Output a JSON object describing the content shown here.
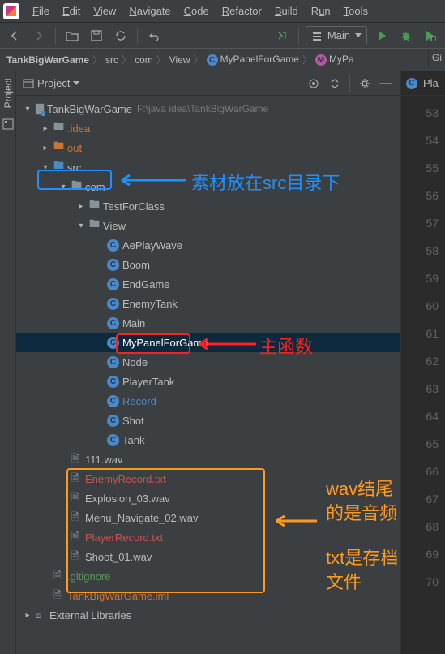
{
  "menu": [
    "File",
    "Edit",
    "View",
    "Navigate",
    "Code",
    "Refactor",
    "Build",
    "Run",
    "Tools"
  ],
  "runConfig": "Main",
  "breadcrumbs": [
    {
      "label": "TankBigWarGame",
      "icon": null,
      "bold": true
    },
    {
      "label": "src",
      "icon": null
    },
    {
      "label": "com",
      "icon": null
    },
    {
      "label": "View",
      "icon": null
    },
    {
      "label": "MyPanelForGame",
      "icon": "c"
    },
    {
      "label": "MyPa",
      "icon": "m"
    }
  ],
  "sideTab": {
    "label": "Project"
  },
  "gitTab": "Gi",
  "panelTitle": "Project",
  "editorTab": "Pla",
  "lineNumbers": [
    "53",
    "54",
    "55",
    "56",
    "57",
    "58",
    "59",
    "60",
    "61",
    "62",
    "63",
    "64",
    "65",
    "66",
    "67",
    "68",
    "69",
    "70"
  ],
  "tree": [
    {
      "depth": 0,
      "chev": "down",
      "icon": "module",
      "label": "TankBigWarGame",
      "cls": "",
      "suffix": "F:\\java idea\\TankBigWarGame"
    },
    {
      "depth": 1,
      "chev": "right",
      "icon": "folder",
      "label": ".idea",
      "cls": "orange"
    },
    {
      "depth": 1,
      "chev": "right",
      "icon": "folder-orange",
      "label": "out",
      "cls": "orange"
    },
    {
      "depth": 1,
      "chev": "down",
      "icon": "folder-blue",
      "label": "src",
      "cls": ""
    },
    {
      "depth": 2,
      "chev": "down",
      "icon": "folder",
      "label": "com",
      "cls": ""
    },
    {
      "depth": 3,
      "chev": "right",
      "icon": "folder",
      "label": "TestForClass",
      "cls": ""
    },
    {
      "depth": 3,
      "chev": "down",
      "icon": "folder",
      "label": "View",
      "cls": ""
    },
    {
      "depth": 4,
      "chev": "",
      "icon": "class",
      "label": "AePlayWave",
      "cls": ""
    },
    {
      "depth": 4,
      "chev": "",
      "icon": "class",
      "label": "Boom",
      "cls": ""
    },
    {
      "depth": 4,
      "chev": "",
      "icon": "class",
      "label": "EndGame",
      "cls": ""
    },
    {
      "depth": 4,
      "chev": "",
      "icon": "class",
      "label": "EnemyTank",
      "cls": ""
    },
    {
      "depth": 4,
      "chev": "",
      "icon": "class",
      "label": "Main",
      "cls": "",
      "selected": false
    },
    {
      "depth": 4,
      "chev": "",
      "icon": "class",
      "label": "MyPanelForGame",
      "cls": "",
      "selected": true
    },
    {
      "depth": 4,
      "chev": "",
      "icon": "class",
      "label": "Node",
      "cls": ""
    },
    {
      "depth": 4,
      "chev": "",
      "icon": "class",
      "label": "PlayerTank",
      "cls": ""
    },
    {
      "depth": 4,
      "chev": "",
      "icon": "class",
      "label": "Record",
      "cls": "blue"
    },
    {
      "depth": 4,
      "chev": "",
      "icon": "class",
      "label": "Shot",
      "cls": ""
    },
    {
      "depth": 4,
      "chev": "",
      "icon": "class",
      "label": "Tank",
      "cls": ""
    },
    {
      "depth": 2,
      "chev": "",
      "icon": "file",
      "label": "111.wav",
      "cls": ""
    },
    {
      "depth": 2,
      "chev": "",
      "icon": "txt",
      "label": "EnemyRecord.txt",
      "cls": "red"
    },
    {
      "depth": 2,
      "chev": "",
      "icon": "file",
      "label": "Explosion_03.wav",
      "cls": ""
    },
    {
      "depth": 2,
      "chev": "",
      "icon": "file",
      "label": "Menu_Navigate_02.wav",
      "cls": ""
    },
    {
      "depth": 2,
      "chev": "",
      "icon": "txt",
      "label": "PlayerRecord.txt",
      "cls": "red"
    },
    {
      "depth": 2,
      "chev": "",
      "icon": "file",
      "label": "Shoot_01.wav",
      "cls": ""
    },
    {
      "depth": 1,
      "chev": "",
      "icon": "file",
      "label": ".gitignore",
      "cls": "green"
    },
    {
      "depth": 1,
      "chev": "",
      "icon": "file",
      "label": "TankBigWarGame.iml",
      "cls": "orange"
    },
    {
      "depth": 0,
      "chev": "right",
      "icon": "lib",
      "label": "External Libraries",
      "cls": ""
    }
  ],
  "annotations": {
    "srcNote": "素材放在src目录下",
    "mainNote": "主函数",
    "wavNote1": "wav结尾",
    "wavNote2": "的是音频",
    "txtNote1": "txt是存档",
    "txtNote2": "文件"
  }
}
